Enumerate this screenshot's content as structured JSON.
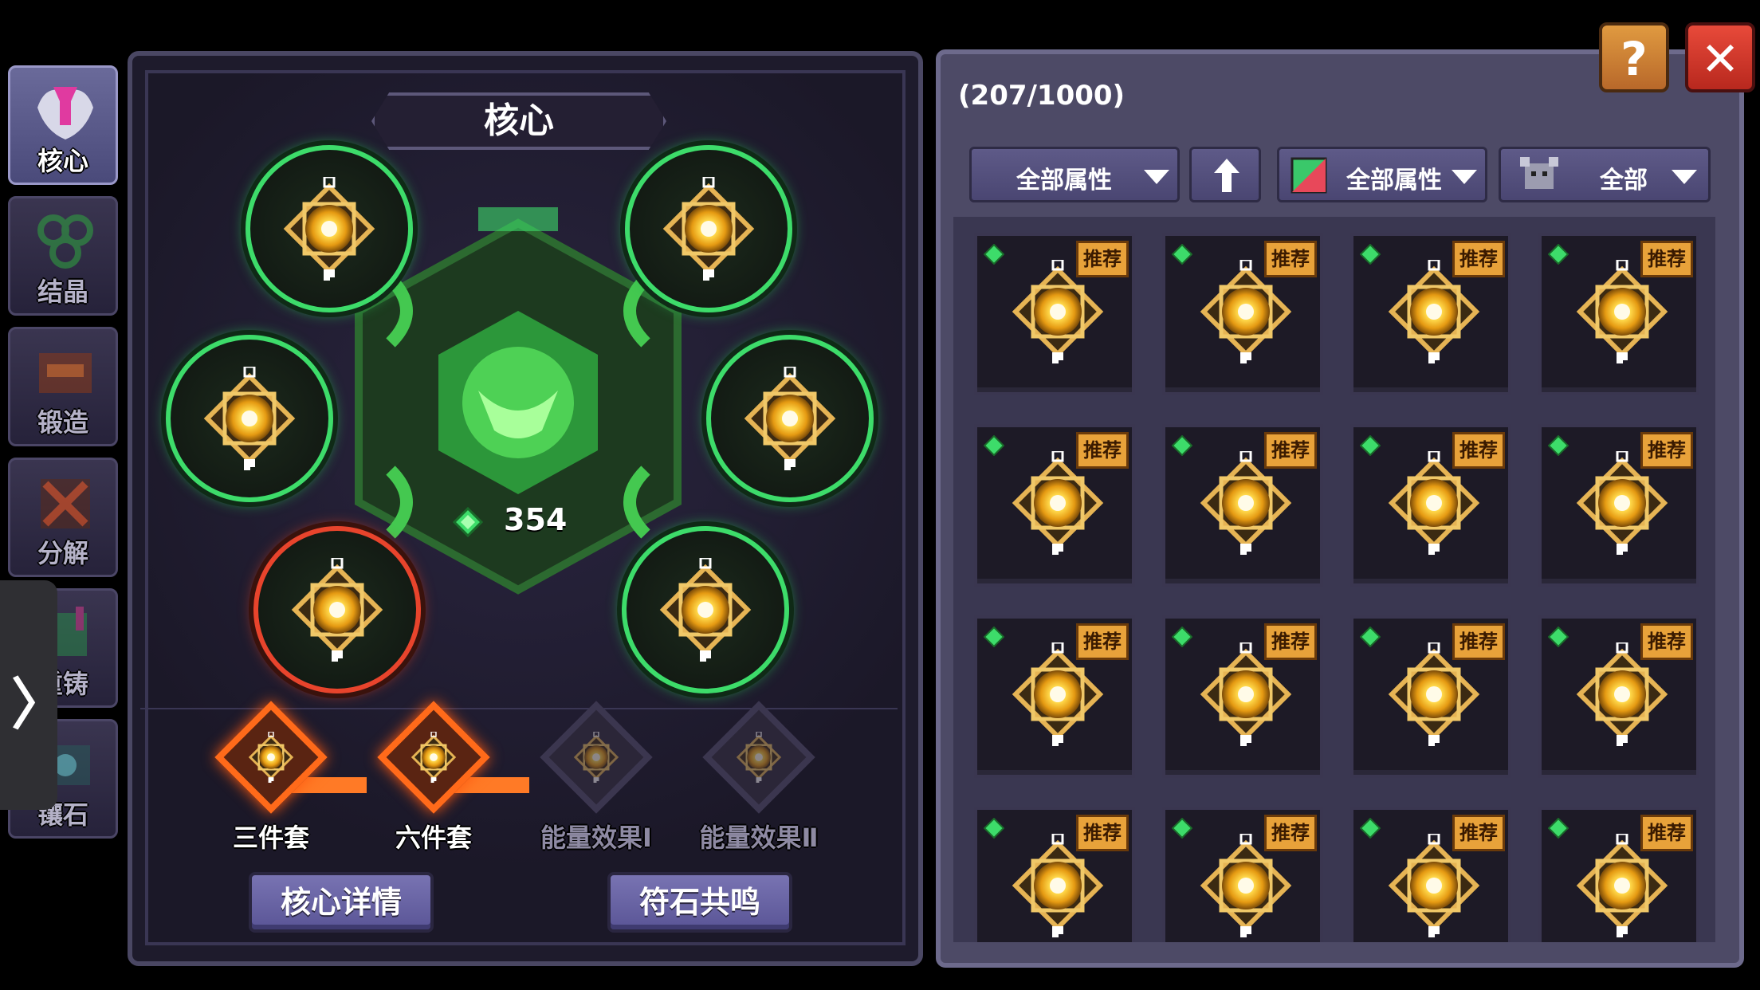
{
  "sidebar": {
    "tabs": [
      {
        "label": "核心",
        "icon": "core-icon",
        "active": true
      },
      {
        "label": "结晶",
        "icon": "crystal-icon",
        "active": false
      },
      {
        "label": "锻造",
        "icon": "forge-icon",
        "active": false
      },
      {
        "label": "分解",
        "icon": "decompose-icon",
        "active": false
      },
      {
        "label": "重铸",
        "icon": "recast-icon",
        "active": false
      },
      {
        "label": "镶石",
        "icon": "inlay-icon",
        "active": false
      }
    ],
    "drawer_glyph": "〉"
  },
  "core": {
    "title": "核心",
    "energy_value": "354",
    "sockets": [
      {
        "state": "filled",
        "ring": "green"
      },
      {
        "state": "filled",
        "ring": "green"
      },
      {
        "state": "filled",
        "ring": "green"
      },
      {
        "state": "filled",
        "ring": "green"
      },
      {
        "state": "filled",
        "ring": "red"
      },
      {
        "state": "filled",
        "ring": "green"
      }
    ],
    "set_bonuses": [
      {
        "label": "三件套",
        "active": true
      },
      {
        "label": "六件套",
        "active": true
      },
      {
        "label": "能量效果Ⅰ",
        "active": false
      },
      {
        "label": "能量效果Ⅱ",
        "active": false
      }
    ],
    "buttons": {
      "details": "核心详情",
      "resonance": "符石共鸣"
    }
  },
  "inventory": {
    "count": "(207/1000)",
    "filters": {
      "attribute_1": "全部属性",
      "sort_icon": "arrow-up-icon",
      "attribute_2": "全部属性",
      "category": "全部"
    },
    "badge_label": "推荐",
    "items_count": 16
  },
  "colors": {
    "socket_green": "#3ddc6a",
    "socket_red": "#e8442c",
    "set_active": "#ff6a1a",
    "badge": "#e8a23a",
    "close_button": "#d23a2a",
    "help_button": "#c8782a"
  }
}
